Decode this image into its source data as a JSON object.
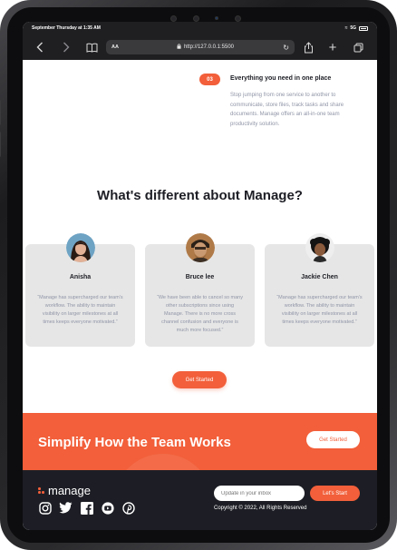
{
  "status": {
    "datetime": "September Thursday at 1:35 AM",
    "signal": "5G"
  },
  "browser": {
    "text_size_label": "AA",
    "url": "http://127.0.0.1:5500"
  },
  "feature": {
    "number": "03",
    "title": "Everything you need in one place",
    "description": "Stop jumping from one service to another to communicate, store files, track tasks and share documents. Manage offers an all-in-one team productivity solution."
  },
  "testimonials": {
    "title": "What's different about Manage?",
    "items": [
      {
        "name": "Anisha",
        "quote": "“Manage has supercharged our team’s workflow. The ability to maintain visibility on larger milestones at all times keeps everyone motivated.”"
      },
      {
        "name": "Bruce lee",
        "quote": "“We have been able to cancel so many other subscriptions since using Manage. There is no more cross channel confusion and everyone is much more focused.”"
      },
      {
        "name": "Jackie Chen",
        "quote": "“Manage has supercharged our team’s workflow. The ability to maintain visibility on larger milestones at all times keeps everyone motivated.”"
      }
    ],
    "button_label": "Get Started"
  },
  "cta": {
    "title": "Simplify How the Team Works",
    "button_label": "Get Started"
  },
  "footer": {
    "logo_text": "manage",
    "social_icons": [
      "instagram-icon",
      "twitter-icon",
      "facebook-icon",
      "youtube-icon",
      "pinterest-icon"
    ],
    "newsletter_placeholder": "Update in your inbox",
    "newsletter_button": "Let's Start",
    "copyright": "Copyright © 2022, All Rights Reserved"
  },
  "colors": {
    "accent": "#f25f3a",
    "dark": "#1d1e25",
    "muted": "#9095a7",
    "card": "#e6e6e6"
  }
}
